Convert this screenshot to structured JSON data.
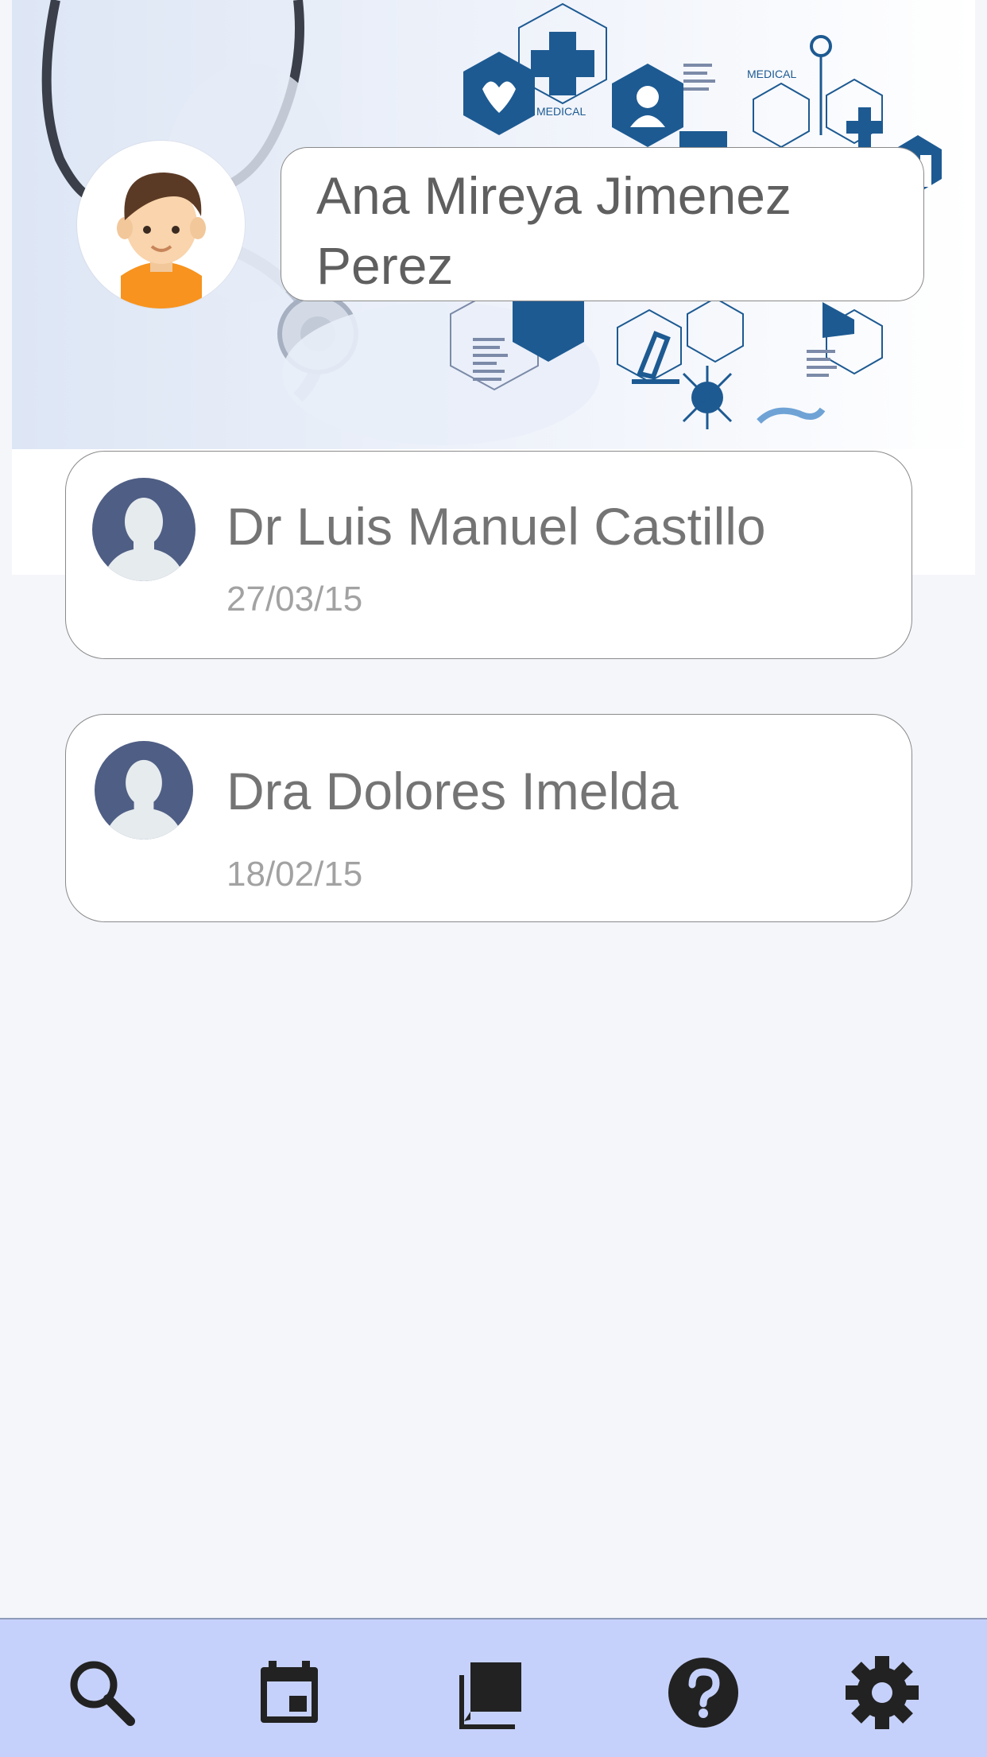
{
  "header": {
    "patient_name": "Ana Mireya Jimenez Perez",
    "background_icon_labels": [
      "MEDICAL",
      "MEDICAL"
    ]
  },
  "doctors": [
    {
      "name": "Dr Luis Manuel Castillo",
      "date": "27/03/15"
    },
    {
      "name": "Dra Dolores Imelda",
      "date": "18/02/15"
    }
  ],
  "bottom_nav": {
    "items": [
      {
        "icon": "search-icon"
      },
      {
        "icon": "calendar-icon"
      },
      {
        "icon": "messages-icon"
      },
      {
        "icon": "help-icon"
      },
      {
        "icon": "settings-icon"
      }
    ]
  },
  "colors": {
    "background": "#f4f6fa",
    "nav_background": "#c6d1fb",
    "medical_blue": "#1d5a92",
    "avatar_blue": "#4f5e84",
    "text_gray": "#5f5f5f",
    "date_gray": "#a2a2a2"
  }
}
